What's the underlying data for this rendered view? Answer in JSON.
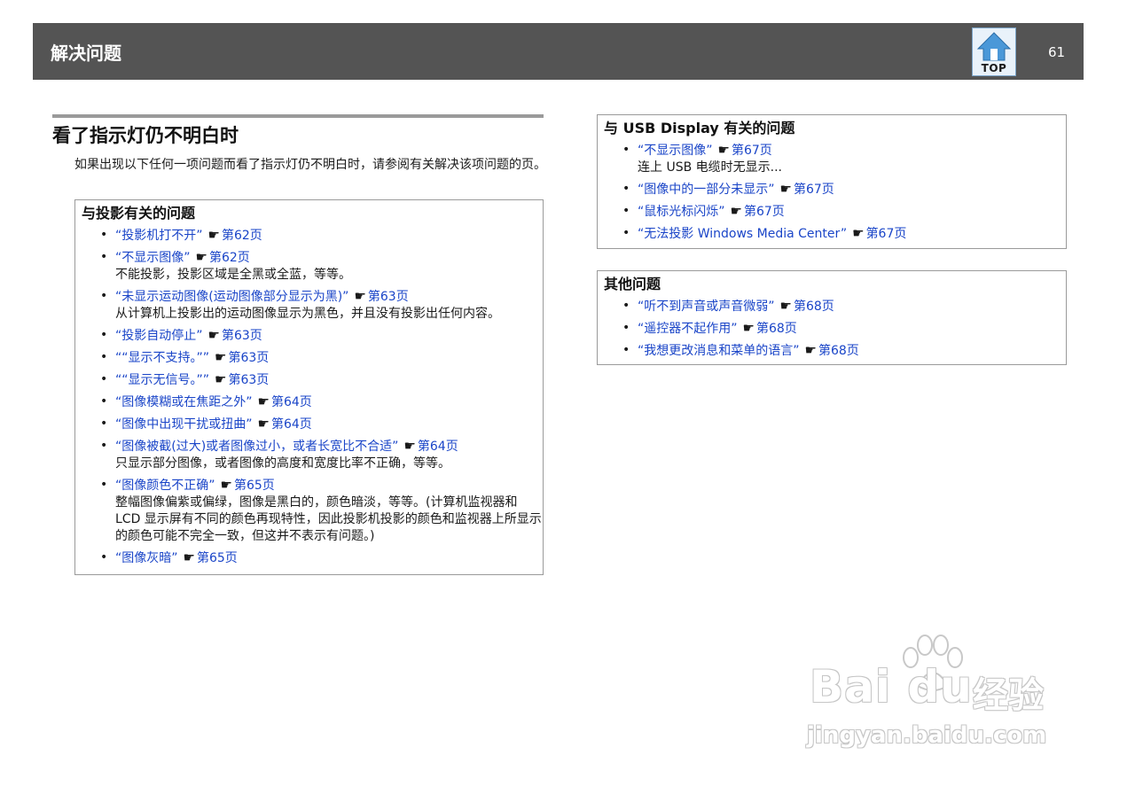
{
  "header": {
    "title": "解决问题",
    "top_label": "TOP",
    "page_number": "61"
  },
  "main": {
    "title": "看了指示灯仍不明白时",
    "intro": "如果出现以下任何一项问题而看了指示灯仍不明白时，请参阅有关解决该项问题的页。"
  },
  "hand_symbol": "☛",
  "projection_box": {
    "title": "与投影有关的问题",
    "items": [
      {
        "text": "“投影机打不开”",
        "page": "第62页",
        "desc": ""
      },
      {
        "text": "“不显示图像”",
        "page": "第62页",
        "desc": "不能投影，投影区域是全黑或全蓝，等等。"
      },
      {
        "text": "“未显示运动图像(运动图像部分显示为黑)”",
        "page": "第63页",
        "desc": "从计算机上投影出的运动图像显示为黑色，并且没有投影出任何内容。"
      },
      {
        "text": "“投影自动停止”",
        "page": "第63页",
        "desc": ""
      },
      {
        "text": "““显示不支持。””",
        "page": "第63页",
        "desc": ""
      },
      {
        "text": "““显示无信号。””",
        "page": "第63页",
        "desc": ""
      },
      {
        "text": "“图像模糊或在焦距之外”",
        "page": "第64页",
        "desc": ""
      },
      {
        "text": "“图像中出现干扰或扭曲”",
        "page": "第64页",
        "desc": ""
      },
      {
        "text": "“图像被截(过大)或者图像过小，或者长宽比不合适”",
        "page": "第64页",
        "desc": "只显示部分图像，或者图像的高度和宽度比率不正确，等等。"
      },
      {
        "text": "“图像颜色不正确”",
        "page": "第65页",
        "desc": "整幅图像偏紫或偏绿，图像是黑白的，颜色暗淡，等等。(计算机监视器和 LCD 显示屏有不同的颜色再现特性，因此投影机投影的颜色和监视器上所显示的颜色可能不完全一致，但这并不表示有问题。)"
      },
      {
        "text": "“图像灰暗”",
        "page": "第65页",
        "desc": ""
      }
    ]
  },
  "usb_box": {
    "title": "与 USB Display 有关的问题",
    "items": [
      {
        "text": "“不显示图像”",
        "page": "第67页",
        "desc": "连上 USB 电缆时无显示..."
      },
      {
        "text": "“图像中的一部分未显示”",
        "page": "第67页",
        "desc": ""
      },
      {
        "text": "“鼠标光标闪烁”",
        "page": "第67页",
        "desc": ""
      },
      {
        "text": "“无法投影 Windows Media Center”",
        "page": "第67页",
        "desc": ""
      }
    ]
  },
  "other_box": {
    "title": "其他问题",
    "items": [
      {
        "text": "“听不到声音或声音微弱”",
        "page": "第68页",
        "desc": ""
      },
      {
        "text": "“遥控器不起作用”",
        "page": "第68页",
        "desc": ""
      },
      {
        "text": "“我想更改消息和菜单的语言”",
        "page": "第68页",
        "desc": ""
      }
    ]
  },
  "watermark": {
    "brand": "Bai du",
    "cn": "经验",
    "url": "jingyan.baidu.com"
  },
  "colors": {
    "header_bg": "#545454",
    "link": "#1a45c8",
    "rule": "#9a9a9a"
  }
}
